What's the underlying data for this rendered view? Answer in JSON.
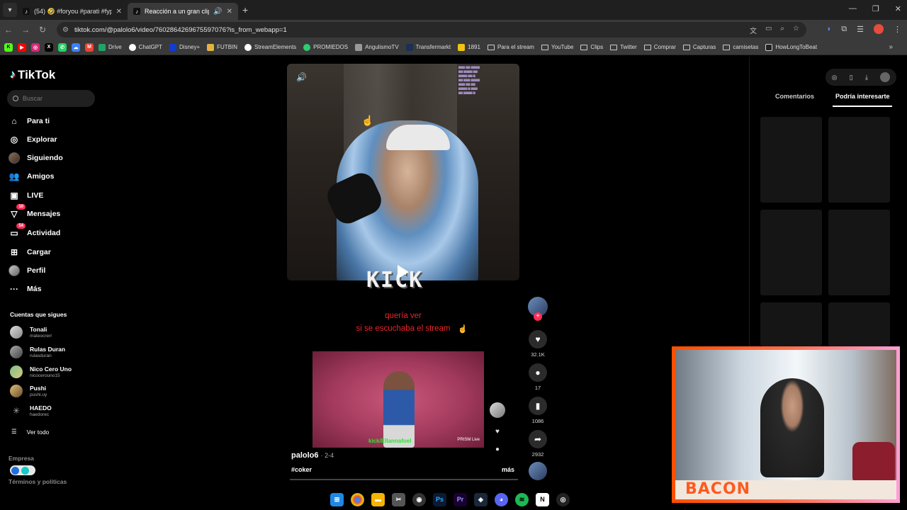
{
  "browser": {
    "tabs": [
      {
        "title": "(54) 🤣 #foryou #parati #fyp #C",
        "active": false
      },
      {
        "title": "Reacción a un gran clip en",
        "active": true
      }
    ],
    "url": "tiktok.com/@palolo6/video/7602864269675597076?is_from_webapp=1",
    "bookmarks": [
      "Drive",
      "ChatGPT",
      "Disney+",
      "FUTBIN",
      "StreamElements",
      "PROMIEDOS",
      "AngulismoTV",
      "Transfermarkt",
      "1891",
      "Para el stream",
      "YouTube",
      "Clips",
      "Twitter",
      "Comprar",
      "Capturas",
      "camisetas",
      "HowLongToBeat"
    ]
  },
  "sidebar": {
    "logo": "TikTok",
    "search_placeholder": "Buscar",
    "nav": [
      {
        "label": "Para ti",
        "icon": "home-icon"
      },
      {
        "label": "Explorar",
        "icon": "compass-icon"
      },
      {
        "label": "Siguiendo",
        "icon": "following-avatar-icon"
      },
      {
        "label": "Amigos",
        "icon": "friends-icon"
      },
      {
        "label": "LIVE",
        "icon": "live-icon"
      },
      {
        "label": "Mensajes",
        "icon": "messages-icon",
        "badge": "10"
      },
      {
        "label": "Actividad",
        "icon": "activity-icon",
        "badge": "54"
      },
      {
        "label": "Cargar",
        "icon": "upload-icon"
      },
      {
        "label": "Perfil",
        "icon": "profile-icon"
      },
      {
        "label": "Más",
        "icon": "more-icon"
      }
    ],
    "following_title": "Cuentas que sigues",
    "accounts": [
      {
        "name": "Tonali",
        "handle": "mateocrerr"
      },
      {
        "name": "Rulas Duran",
        "handle": "rulasduran"
      },
      {
        "name": "Nico Cero Uno",
        "handle": "nicocerouno15"
      },
      {
        "name": "Pushi",
        "handle": "pushi.uy"
      },
      {
        "name": "HAEDO",
        "handle": "haedorec"
      }
    ],
    "see_all": "Ver todo",
    "footer": [
      "Empresa",
      "Términos y políticas"
    ]
  },
  "video": {
    "overlay_text": "KICK",
    "caption_line1": "quería ver",
    "caption_line2": "si se escuchaba el stream",
    "clip_tag": "kick/Ellannafoel",
    "clip_brand": "PRISM Live",
    "author": "palolo6",
    "date": "· 2-4",
    "hashtag": "#coker",
    "more": "más"
  },
  "actions": {
    "likes": "32.1K",
    "comments": "17",
    "saves": "1086",
    "shares": "2932"
  },
  "right_panel": {
    "tab_comments": "Comentarios",
    "tab_interest": "Podría interesarte"
  },
  "webcam": {
    "brand": "BACON"
  },
  "colors": {
    "accent": "#fe2c55",
    "caption": "#e8242b",
    "bacon": "#ff5a1f"
  }
}
